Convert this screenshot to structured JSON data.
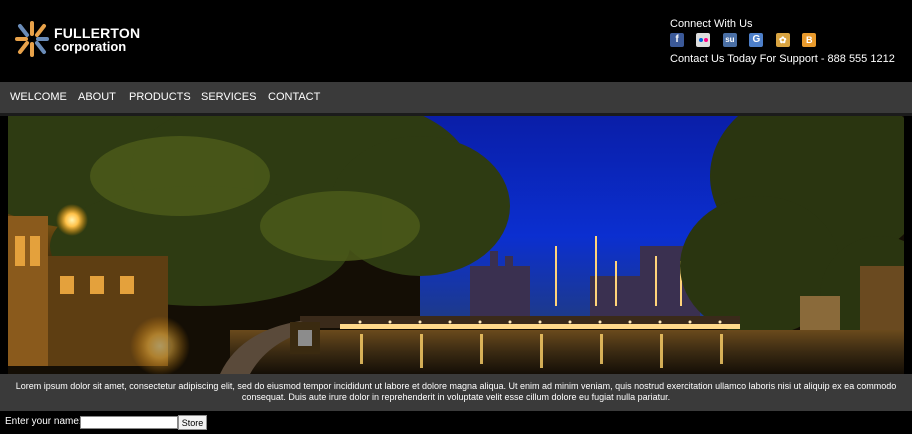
{
  "brand": {
    "name_line1": "FULLERTON",
    "name_line2": "corporation",
    "colors": {
      "accent_orange": "#e8a24a",
      "accent_blue": "#6a8cb8"
    }
  },
  "connect": {
    "title": "Connect With Us",
    "social_icons": [
      "facebook-icon",
      "flickr-icon",
      "stumbleupon-icon",
      "google-icon",
      "delicious-icon",
      "blogger-icon"
    ],
    "support_text": "Contact Us Today For Support - 888 555 1212"
  },
  "nav": {
    "items": [
      {
        "label": "WELCOME"
      },
      {
        "label": "ABOUT"
      },
      {
        "label": "PRODUCTS"
      },
      {
        "label": "SERVICES"
      },
      {
        "label": "CONTACT"
      }
    ],
    "background": "#3a3a3a"
  },
  "hero": {
    "subject": "night-river-bridge-photo"
  },
  "caption": {
    "text": "Lorem ipsum dolor sit amet, consectetur adipiscing elit, sed do eiusmod tempor incididunt ut labore et dolore magna aliqua. Ut enim ad minim veniam, quis nostrud exercitation ullamco laboris nisi ut aliquip ex ea commodo consequat. Duis aute irure dolor in reprehenderit in voluptate velit esse cillum dolore eu fugiat nulla pariatur."
  },
  "form": {
    "label": "Enter your name:",
    "input_value": "",
    "button_label": "Store"
  }
}
